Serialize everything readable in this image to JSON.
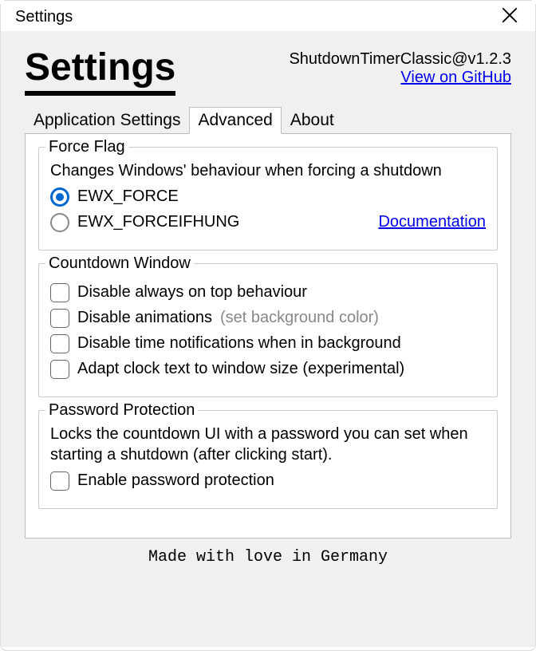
{
  "window": {
    "title": "Settings"
  },
  "header": {
    "heading": "Settings",
    "app_version": "ShutdownTimerClassic@v1.2.3",
    "github_link": "View on GitHub"
  },
  "tabs": {
    "t0": "Application Settings",
    "t1": "Advanced",
    "t2": "About",
    "active": 1
  },
  "force_flag": {
    "title": "Force Flag",
    "desc": "Changes Windows' behaviour when forcing a shutdown",
    "opt1": "EWX_FORCE",
    "opt2": "EWX_FORCEIFHUNG",
    "doc_link": "Documentation"
  },
  "countdown": {
    "title": "Countdown Window",
    "c1": "Disable always on top behaviour",
    "c2": "Disable animations",
    "c2_hint": "(set background color)",
    "c3": "Disable time notifications when in background",
    "c4": "Adapt clock text to window size (experimental)"
  },
  "password": {
    "title": "Password Protection",
    "desc": "Locks the countdown UI with a password you can set when starting a shutdown (after clicking start).",
    "c1": "Enable password protection"
  },
  "footer": "Made with love in Germany"
}
